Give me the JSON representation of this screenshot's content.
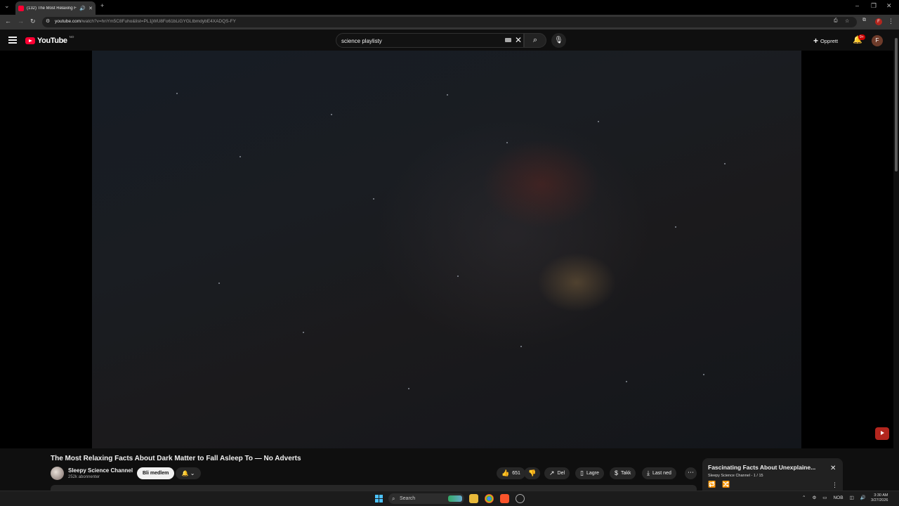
{
  "browser": {
    "tab_title": "(132) The Most Relaxing Fa",
    "url_host": "youtube.com",
    "url_path": "/watch?v=hnYm5C8Fuho&list=PL1jWU8Fo61bLiGYGLtbmdybE4XADQS-FY"
  },
  "youtube": {
    "logo_text": "YouTube",
    "country_code": "NO",
    "search_value": "science playlisty",
    "create_label": "Opprett",
    "notification_count": "9+",
    "avatar_letter": "F"
  },
  "video": {
    "title": "The Most Relaxing Facts About Dark Matter to Fall Asleep To — No Adverts",
    "channel_name": "Sleepy Science Channel",
    "subscribers": "252k abonnenter",
    "join_label": "Bli medlem",
    "like_count": "651",
    "share_label": "Del",
    "save_label": "Lagre",
    "thanks_label": "Takk",
    "download_label": "Last ned"
  },
  "playlist": {
    "title": "Fascinating Facts About Unexplaine...",
    "channel": "Sleepy Science Channel",
    "position": "1 / 15"
  },
  "taskbar": {
    "search_label": "Search",
    "language": "NOB",
    "time": "3:30 AM",
    "date": "3/27/2026"
  },
  "icons": {
    "accent": "#ff0033",
    "notification_badge": "#cc0000",
    "start": "#4cc2ff"
  }
}
